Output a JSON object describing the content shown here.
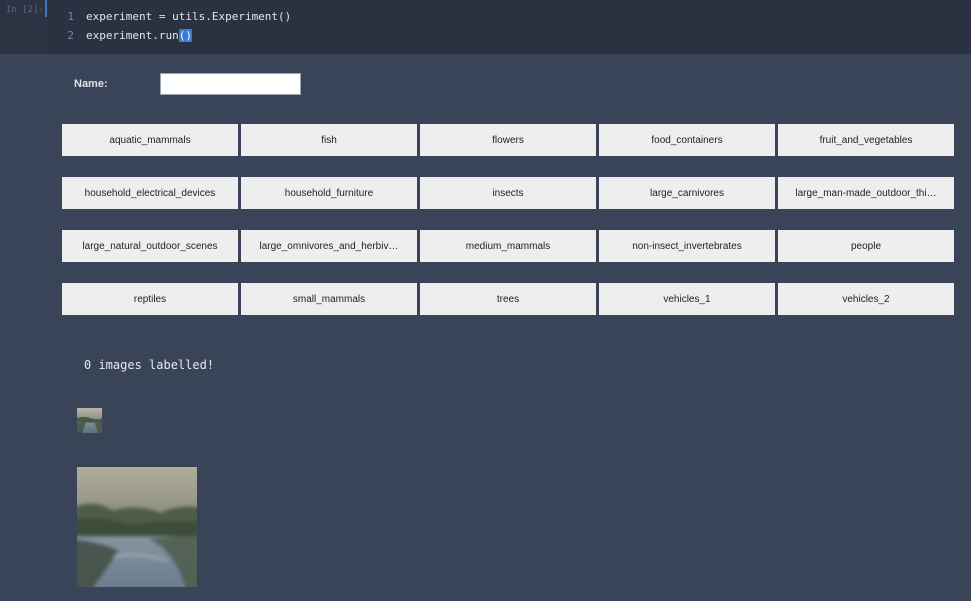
{
  "cell": {
    "prompt": "In [2]:",
    "lines": [
      {
        "number": "1",
        "code": "experiment = utils.Experiment()"
      },
      {
        "number": "2",
        "code_before": "experiment.run",
        "code_highlight": "()"
      }
    ]
  },
  "form": {
    "name_label": "Name:",
    "name_value": ""
  },
  "categories": [
    [
      "aquatic_mammals",
      "fish",
      "flowers",
      "food_containers",
      "fruit_and_vegetables"
    ],
    [
      "household_electrical_devices",
      "household_furniture",
      "insects",
      "large_carnivores",
      "large_man-made_outdoor_thi…"
    ],
    [
      "large_natural_outdoor_scenes",
      "large_omnivores_and_herbiv…",
      "medium_mammals",
      "non-insect_invertebrates",
      "people"
    ],
    [
      "reptiles",
      "small_mammals",
      "trees",
      "vehicles_1",
      "vehicles_2"
    ]
  ],
  "status": "0 images labelled!",
  "images": {
    "thumbnail_alt": "river-landscape-thumbnail",
    "preview_alt": "river-landscape-preview"
  },
  "colors": {
    "background": "#3a4458",
    "cell_background": "#2a3140",
    "button_background": "#eeeeee",
    "accent": "#3c7ad6"
  }
}
